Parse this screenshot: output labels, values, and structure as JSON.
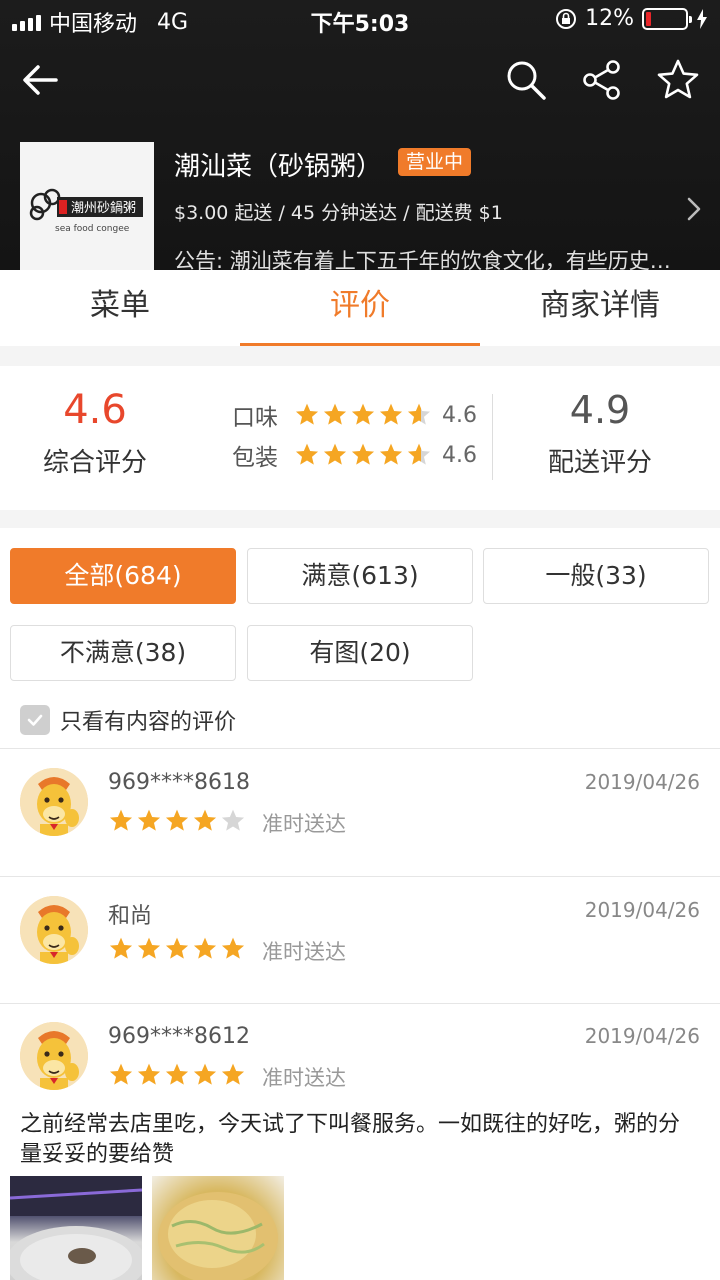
{
  "status_bar": {
    "carrier": "中国移动",
    "network": "4G",
    "time": "下午5:03",
    "battery_percent": "12%",
    "battery_level": 0.12,
    "battery_color": "#e8262a"
  },
  "header": {
    "icons": [
      "back-arrow-icon",
      "search-icon",
      "share-icon",
      "star-icon"
    ]
  },
  "shop": {
    "name": "潮汕菜（砂锅粥）",
    "status_badge": "营业中",
    "info": "$3.00 起送 / 45 分钟送达 / 配送费 $1",
    "notice": "公告: 潮汕菜有着上下五千年的饮食文化，有些历史…",
    "logo_text": "潮州砂鍋粥",
    "logo_subtext": "sea food congee"
  },
  "tabs": [
    {
      "label": "菜单",
      "active": false
    },
    {
      "label": "评价",
      "active": true
    },
    {
      "label": "商家详情",
      "active": false
    }
  ],
  "ratings": {
    "overall_score": "4.6",
    "overall_label": "综合评分",
    "taste_label": "口味",
    "taste_score": "4.6",
    "packaging_label": "包装",
    "packaging_score": "4.6",
    "delivery_score": "4.9",
    "delivery_label": "配送评分"
  },
  "filters": {
    "all": "全部(684)",
    "satisfied": "满意(613)",
    "average": "一般(33)",
    "unsatisfied": "不满意(38)",
    "with_photos": "有图(20)"
  },
  "only_with_content": {
    "label": "只看有内容的评价",
    "checked": true
  },
  "reviews": [
    {
      "user": "969****8618",
      "date": "2019/04/26",
      "stars": 4,
      "tag": "准时送达"
    },
    {
      "user": "和尚",
      "date": "2019/04/26",
      "stars": 5,
      "tag": "准时送达"
    },
    {
      "user": "969****8612",
      "date": "2019/04/26",
      "stars": 5,
      "tag": "准时送达",
      "text": "之前经常去店里吃，今天试了下叫餐服务。一如既往的好吃，粥的分量妥妥的要给赞"
    }
  ],
  "colors": {
    "accent": "#f07b2a",
    "overall_score": "#e8472c",
    "star_on": "#f5a623",
    "star_off": "#d6d6d6"
  }
}
